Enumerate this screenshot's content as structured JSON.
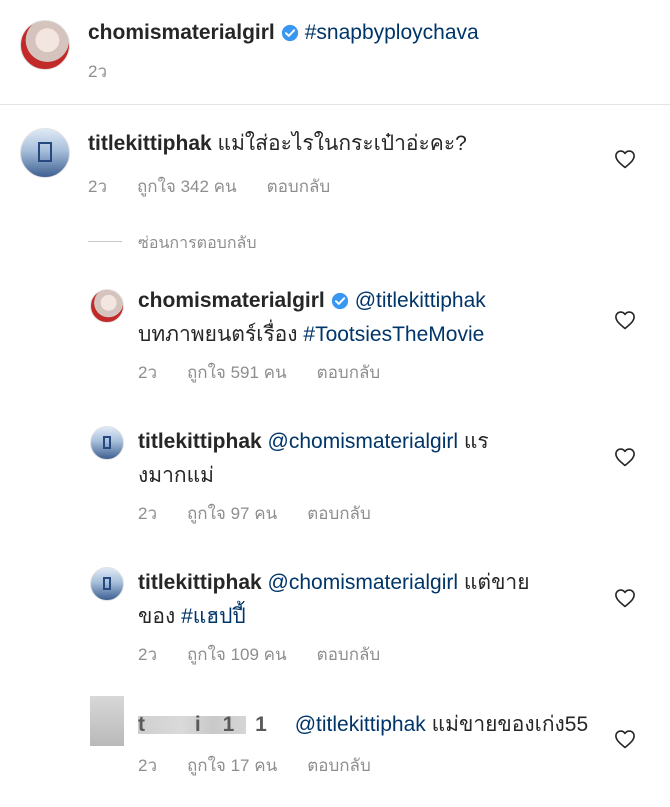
{
  "post": {
    "username": "chomismaterialgirl",
    "caption": "#snapbyploychava",
    "time": "2ว"
  },
  "comments": [
    {
      "username": "titlekittiphak",
      "text": "แม่ใส่อะไรในกระเป๋าอ่ะคะ?",
      "time": "2ว",
      "likes": "ถูกใจ 342 คน",
      "reply": "ตอบกลับ"
    }
  ],
  "hide_replies": "ซ่อนการตอบกลับ",
  "replies": [
    {
      "username": "chomismaterialgirl",
      "mention": "@titlekittiphak",
      "text_prefix": "บทภาพยนตร์เรื่อง ",
      "hashtag": "#TootsiesTheMovie",
      "time": "2ว",
      "likes": "ถูกใจ 591 คน",
      "reply": "ตอบกลับ"
    },
    {
      "username": "titlekittiphak",
      "mention": "@chomismaterialgirl",
      "text_line1": " แร",
      "text_line2": "งมากแม่",
      "time": "2ว",
      "likes": "ถูกใจ 97 คน",
      "reply": "ตอบกลับ"
    },
    {
      "username": "titlekittiphak",
      "mention": "@chomismaterialgirl",
      "text_line1": " แต่ขาย",
      "text_line2": "ของ ",
      "hashtag": "#แฮปปี้",
      "time": "2ว",
      "likes": "ถูกใจ 109 คน",
      "reply": "ตอบกลับ"
    },
    {
      "username_visible": "t i11",
      "mention": "@titlekittiphak",
      "text": " แม่ขายของเก่ง55",
      "time": "2ว",
      "likes": "ถูกใจ 17 คน",
      "reply": "ตอบกลับ"
    }
  ],
  "colors": {
    "text": "#262626",
    "link": "#003569",
    "meta": "#8e8e8e",
    "verified": "#3897f0"
  },
  "icons": {
    "verified": "verified-badge-icon",
    "like": "heart-outline-icon"
  }
}
